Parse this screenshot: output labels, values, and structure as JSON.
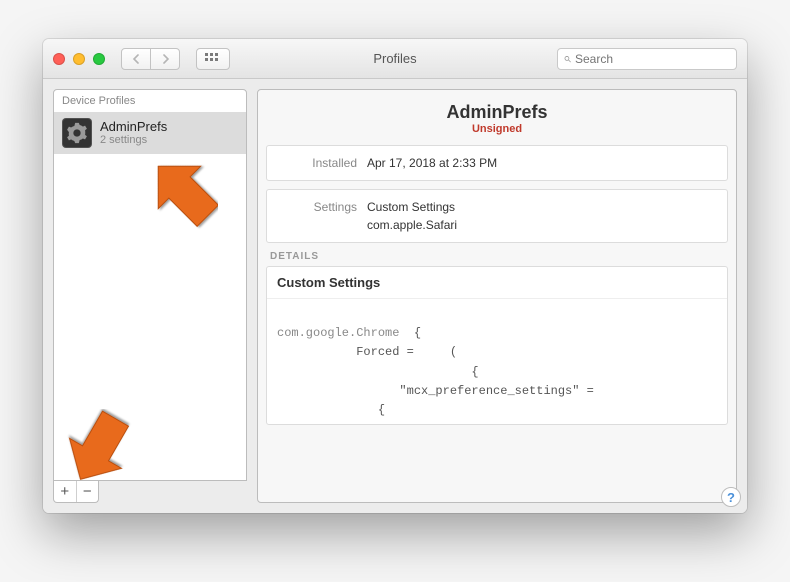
{
  "titlebar": {
    "title": "Profiles",
    "search_placeholder": "Search"
  },
  "sidebar": {
    "header": "Device Profiles",
    "items": [
      {
        "name": "AdminPrefs",
        "subtitle": "2 settings",
        "icon": "gear-icon"
      }
    ],
    "footer": {
      "plus": "+",
      "minus": "−"
    }
  },
  "detail": {
    "title": "AdminPrefs",
    "status": "Unsigned",
    "installed_label": "Installed",
    "installed_value": "Apr 17, 2018 at 2:33 PM",
    "settings_label": "Settings",
    "settings_value": "Custom Settings",
    "settings_bundle": "com.apple.Safari",
    "details_header": "DETAILS",
    "details_title": "Custom Settings",
    "details_domain": "com.google.Chrome",
    "details_body": "  {\n           Forced =     (\n                           {\n                 \"mcx_preference_settings\" =\n              {",
    "help": "?"
  },
  "colors": {
    "unsigned": "#c0392b",
    "accent": "#4a90d9"
  }
}
